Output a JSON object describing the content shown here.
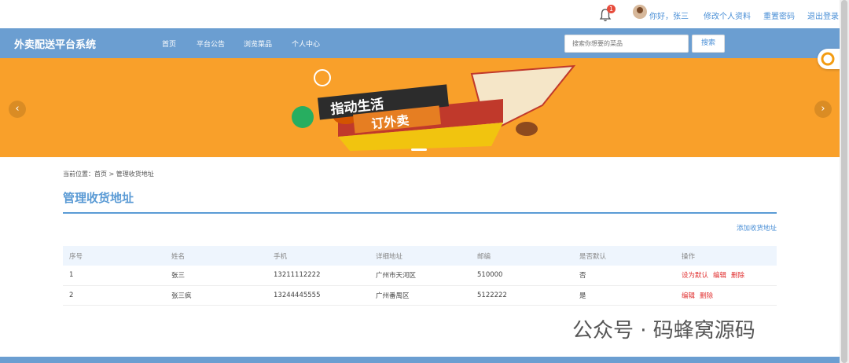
{
  "topbar": {
    "notification_count": "1",
    "greeting": "你好，张三",
    "edit_profile": "修改个人资料",
    "reset_password": "重置密码",
    "logout": "退出登录"
  },
  "navbar": {
    "brand": "外卖配送平台系统",
    "items": [
      "首页",
      "平台公告",
      "浏览菜品",
      "个人中心"
    ],
    "search_placeholder": "搜索你想要的菜品",
    "search_button": "搜索"
  },
  "banner": {
    "headline": "指动生活",
    "subline": "订外卖",
    "prev_icon": "‹",
    "next_icon": "›"
  },
  "breadcrumb": {
    "prefix": "当前位置：",
    "home": "首页",
    "sep": " > ",
    "current": "管理收货地址"
  },
  "page": {
    "title": "管理收货地址",
    "add_link": "添加收货地址"
  },
  "table": {
    "headers": [
      "序号",
      "姓名",
      "手机",
      "详细地址",
      "邮编",
      "是否默认",
      "操作"
    ],
    "rows": [
      {
        "no": "1",
        "name": "张三",
        "phone": "13211112222",
        "address": "广州市天河区",
        "zip": "510000",
        "default": "否",
        "ops": [
          "设为默认",
          "编辑",
          "删除"
        ]
      },
      {
        "no": "2",
        "name": "张三疯",
        "phone": "13244445555",
        "address": "广州番禺区",
        "zip": "5122222",
        "default": "是",
        "ops": [
          "编辑",
          "删除"
        ]
      }
    ]
  },
  "watermark": "公众号 · 码蜂窝源码",
  "colors": {
    "nav": "#6b9ed1",
    "banner": "#f9a02a",
    "accent": "#5b9bd5",
    "danger": "#e03030"
  }
}
